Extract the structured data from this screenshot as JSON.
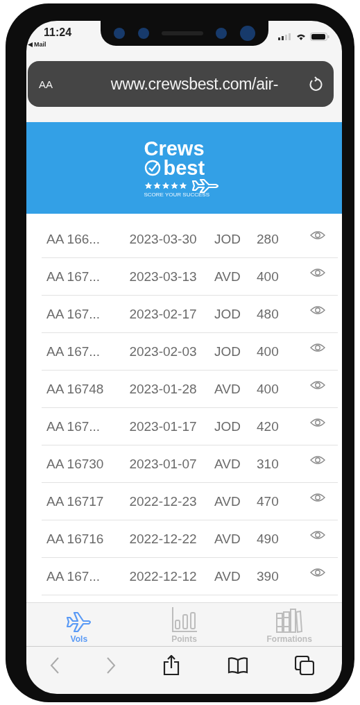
{
  "status_bar": {
    "time": "11:24",
    "back_app": "Mail"
  },
  "address_bar": {
    "text_size_label": "AA",
    "url": "www.crewsbest.com/air-"
  },
  "header": {
    "logo_top": "Crews",
    "logo_bottom": "best",
    "tagline": "SCORE YOUR SUCCESS"
  },
  "flights": [
    {
      "flight": "AA 166...",
      "date": "2023-03-30",
      "type": "JOD",
      "amount": "280"
    },
    {
      "flight": "AA 167...",
      "date": "2023-03-13",
      "type": "AVD",
      "amount": "400"
    },
    {
      "flight": "AA 167...",
      "date": "2023-02-17",
      "type": "JOD",
      "amount": "480"
    },
    {
      "flight": "AA 167...",
      "date": "2023-02-03",
      "type": "JOD",
      "amount": "400"
    },
    {
      "flight": "AA 16748",
      "date": "2023-01-28",
      "type": "AVD",
      "amount": "400"
    },
    {
      "flight": "AA 167...",
      "date": "2023-01-17",
      "type": "JOD",
      "amount": "420"
    },
    {
      "flight": "AA 16730",
      "date": "2023-01-07",
      "type": "AVD",
      "amount": "310"
    },
    {
      "flight": "AA 16717",
      "date": "2022-12-23",
      "type": "AVD",
      "amount": "470"
    },
    {
      "flight": "AA 16716",
      "date": "2022-12-22",
      "type": "AVD",
      "amount": "490"
    },
    {
      "flight": "AA 167...",
      "date": "2022-12-12",
      "type": "AVD",
      "amount": "390"
    }
  ],
  "tabs": [
    {
      "label": "Vols",
      "kind": "plane",
      "selected": true
    },
    {
      "label": "Points",
      "kind": "chart",
      "selected": false
    },
    {
      "label": "Formations",
      "kind": "books",
      "selected": false
    }
  ]
}
